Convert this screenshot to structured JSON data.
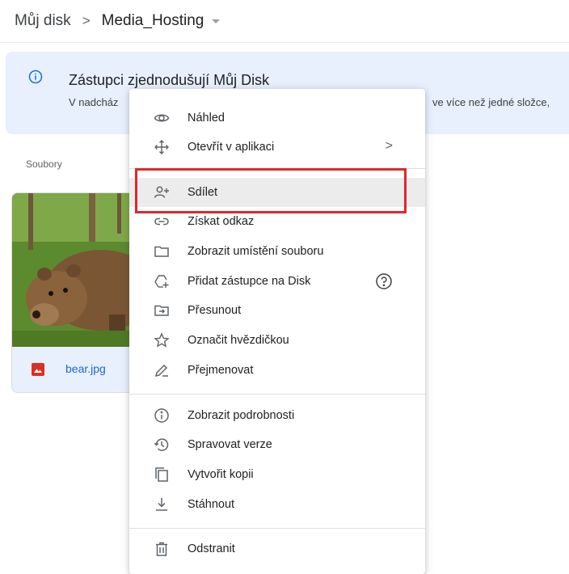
{
  "breadcrumb": {
    "root": "Můj disk",
    "separator": ">",
    "current": "Media_Hosting"
  },
  "banner": {
    "title": "Zástupci zjednodušují Můj Disk",
    "body_start": "V nadcház",
    "body_end": "ve více než jedné složce,"
  },
  "section": {
    "files_label": "Soubory"
  },
  "file": {
    "name": "bear.jpg"
  },
  "menu": {
    "items": [
      {
        "label": "Náhled",
        "icon": "eye-icon"
      },
      {
        "label": "Otevřít v aplikaci",
        "icon": "move-arrows-icon",
        "trailing": ">"
      },
      {
        "label": "Sdílet",
        "icon": "person-add-icon",
        "highlighted": true
      },
      {
        "label": "Získat odkaz",
        "icon": "link-icon"
      },
      {
        "label": "Zobrazit umístění souboru",
        "icon": "folder-icon"
      },
      {
        "label": "Přidat zástupce na Disk",
        "icon": "add-shortcut-icon",
        "trailing_icon": "help-icon"
      },
      {
        "label": "Přesunout",
        "icon": "move-to-folder-icon"
      },
      {
        "label": "Označit hvězdičkou",
        "icon": "star-icon"
      },
      {
        "label": "Přejmenovat",
        "icon": "pencil-icon"
      },
      {
        "label": "Zobrazit podrobnosti",
        "icon": "info-icon"
      },
      {
        "label": "Spravovat verze",
        "icon": "history-icon"
      },
      {
        "label": "Vytvořit kopii",
        "icon": "copy-icon"
      },
      {
        "label": "Stáhnout",
        "icon": "download-icon"
      },
      {
        "label": "Odstranit",
        "icon": "trash-icon"
      }
    ]
  },
  "colors": {
    "highlight_box": "#e2262d",
    "banner_bg": "#e8f0fe",
    "link": "#1967d2"
  }
}
